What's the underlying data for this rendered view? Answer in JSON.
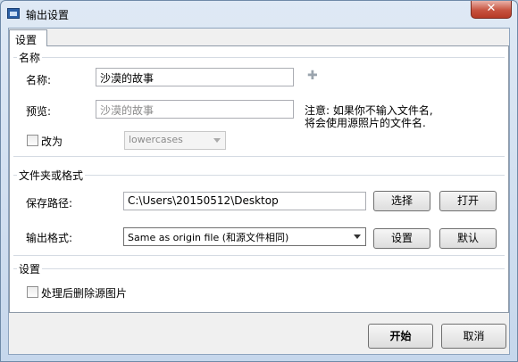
{
  "window": {
    "title": "输出设置",
    "close_glyph": "✕"
  },
  "tabs": [
    {
      "label": "设置"
    }
  ],
  "name_group": {
    "title": "名称",
    "name_label": "名称:",
    "name_value": "沙漠的故事",
    "add_glyph": "✚",
    "preview_label": "预览:",
    "preview_value": "沙漠的故事",
    "note_line1": "注意: 如果你不输入文件名,",
    "note_line2": "将会使用源照片的文件名.",
    "change_label": "改为",
    "case_value": "lowercases"
  },
  "folder_group": {
    "title": "文件夹或格式",
    "path_label": "保存路径:",
    "path_value": "C:\\Users\\20150512\\Desktop",
    "choose_label": "选择",
    "open_label": "打开",
    "format_label": "输出格式:",
    "format_value": "Same as origin file (和源文件相同)",
    "settings_label": "设置",
    "default_label": "默认"
  },
  "settings_group": {
    "title": "设置",
    "delete_label": "处理后删除源图片"
  },
  "footer": {
    "start_label": "开始",
    "cancel_label": "取消"
  }
}
